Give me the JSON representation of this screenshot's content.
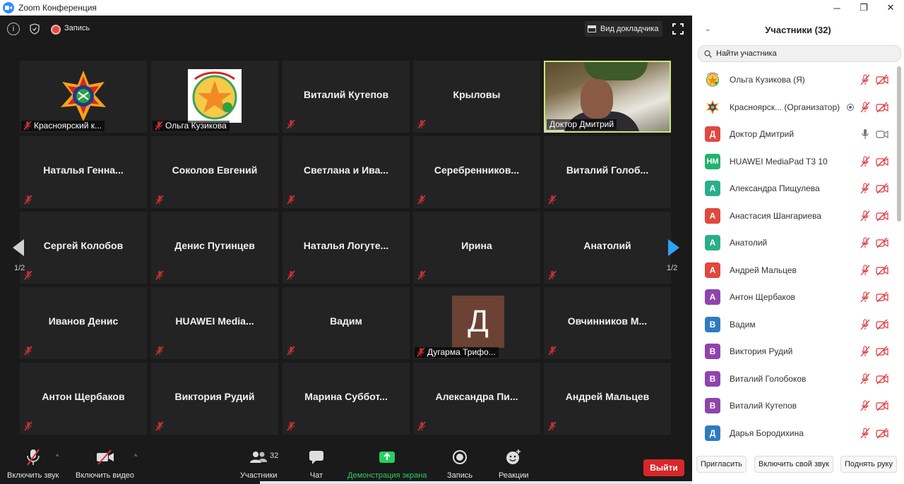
{
  "window": {
    "title": "Zoom Конференция",
    "minimize": "─",
    "maximize": "❐",
    "close": "✕"
  },
  "topbar": {
    "info_icon": "i",
    "recording_label": "Запись",
    "speaker_view_label": "Вид докладчика"
  },
  "grid": {
    "page_indicator_left": "1/2",
    "page_indicator_right": "1/2",
    "tiles": [
      {
        "name": "",
        "caption": "Красноярский к...",
        "kind": "logo1"
      },
      {
        "name": "",
        "caption": "Ольга Кузикова",
        "kind": "logo2"
      },
      {
        "name": "Виталий Кутепов",
        "caption": "",
        "kind": "name"
      },
      {
        "name": "Крыловы",
        "caption": "",
        "kind": "name"
      },
      {
        "name": "",
        "caption": "Доктор Дмитрий",
        "kind": "video"
      },
      {
        "name": "Наталья   Генна...",
        "caption": "",
        "kind": "name"
      },
      {
        "name": "Соколов Евгений",
        "caption": "",
        "kind": "name"
      },
      {
        "name": "Светлана  и Ива...",
        "caption": "",
        "kind": "name"
      },
      {
        "name": "Серебренников...",
        "caption": "",
        "kind": "name"
      },
      {
        "name": "Виталий  Голоб...",
        "caption": "",
        "kind": "name"
      },
      {
        "name": "Сергей Колобов",
        "caption": "",
        "kind": "name"
      },
      {
        "name": "Денис Путинцев",
        "caption": "",
        "kind": "name"
      },
      {
        "name": "Наталья  Логуте...",
        "caption": "",
        "kind": "name"
      },
      {
        "name": "Ирина",
        "caption": "",
        "kind": "name"
      },
      {
        "name": "Анатолий",
        "caption": "",
        "kind": "name"
      },
      {
        "name": "Иванов Денис",
        "caption": "",
        "kind": "name"
      },
      {
        "name": "HUAWEI  Media...",
        "caption": "",
        "kind": "name"
      },
      {
        "name": "Вадим",
        "caption": "",
        "kind": "name"
      },
      {
        "name": "",
        "caption": "Дугарма Трифо...",
        "kind": "letter",
        "letter": "Д"
      },
      {
        "name": "Овчинников  М...",
        "caption": "",
        "kind": "name"
      },
      {
        "name": "Антон Щербаков",
        "caption": "",
        "kind": "name"
      },
      {
        "name": "Виктория Рудий",
        "caption": "",
        "kind": "name"
      },
      {
        "name": "Марина  Суббот...",
        "caption": "",
        "kind": "name"
      },
      {
        "name": "Александра  Пи...",
        "caption": "",
        "kind": "name"
      },
      {
        "name": "Андрей Мальцев",
        "caption": "",
        "kind": "name"
      }
    ]
  },
  "toolbar": {
    "unmute_label": "Включить звук",
    "start_video_label": "Включить видео",
    "participants_label": "Участники",
    "participants_count": "32",
    "chat_label": "Чат",
    "share_label": "Демонстрация экрана",
    "record_label": "Запись",
    "reactions_label": "Реакции",
    "leave_label": "Выйти"
  },
  "panel": {
    "title": "Участники (32)",
    "search_placeholder": "Найти участника",
    "participants": [
      {
        "name": "Ольга Кузикова (Я)",
        "avatar": "",
        "color": "#f4a300",
        "img": "logo2",
        "mic": "muted",
        "cam": "off"
      },
      {
        "name": "Красноярск... (Организатор)",
        "avatar": "",
        "color": "#333333",
        "img": "logo1",
        "mic": "muted",
        "cam": "off",
        "host": true
      },
      {
        "name": "Доктор Дмитрий",
        "avatar": "Д",
        "color": "#e0483e",
        "mic": "on",
        "cam": "on"
      },
      {
        "name": "HUAWEI MediaPad T3 10",
        "avatar": "HM",
        "color": "#23b26d",
        "mic": "muted",
        "cam": "off"
      },
      {
        "name": "Александра Пищулева",
        "avatar": "А",
        "color": "#2bae8a",
        "mic": "muted",
        "cam": "off"
      },
      {
        "name": "Анастасия Шангариева",
        "avatar": "А",
        "color": "#e0483e",
        "mic": "muted",
        "cam": "off"
      },
      {
        "name": "Анатолий",
        "avatar": "А",
        "color": "#2bae8a",
        "mic": "muted",
        "cam": "off"
      },
      {
        "name": "Андрей Мальцев",
        "avatar": "А",
        "color": "#e0483e",
        "mic": "muted",
        "cam": "off"
      },
      {
        "name": "Антон Щербаков",
        "avatar": "А",
        "color": "#8e44ad",
        "mic": "muted",
        "cam": "off"
      },
      {
        "name": "Вадим",
        "avatar": "В",
        "color": "#2e7bbf",
        "mic": "muted",
        "cam": "off"
      },
      {
        "name": "Виктория Рудий",
        "avatar": "В",
        "color": "#8e44ad",
        "mic": "muted",
        "cam": "off"
      },
      {
        "name": "Виталий Голобоков",
        "avatar": "В",
        "color": "#8e44ad",
        "mic": "muted",
        "cam": "off"
      },
      {
        "name": "Виталий Кутепов",
        "avatar": "В",
        "color": "#8e44ad",
        "mic": "muted",
        "cam": "off"
      },
      {
        "name": "Дарья Бородихина",
        "avatar": "Д",
        "color": "#2e7bbf",
        "mic": "muted",
        "cam": "off"
      }
    ],
    "invite_label": "Пригласить",
    "unmute_self_label": "Включить свой звук",
    "raise_hand_label": "Поднять руку"
  }
}
